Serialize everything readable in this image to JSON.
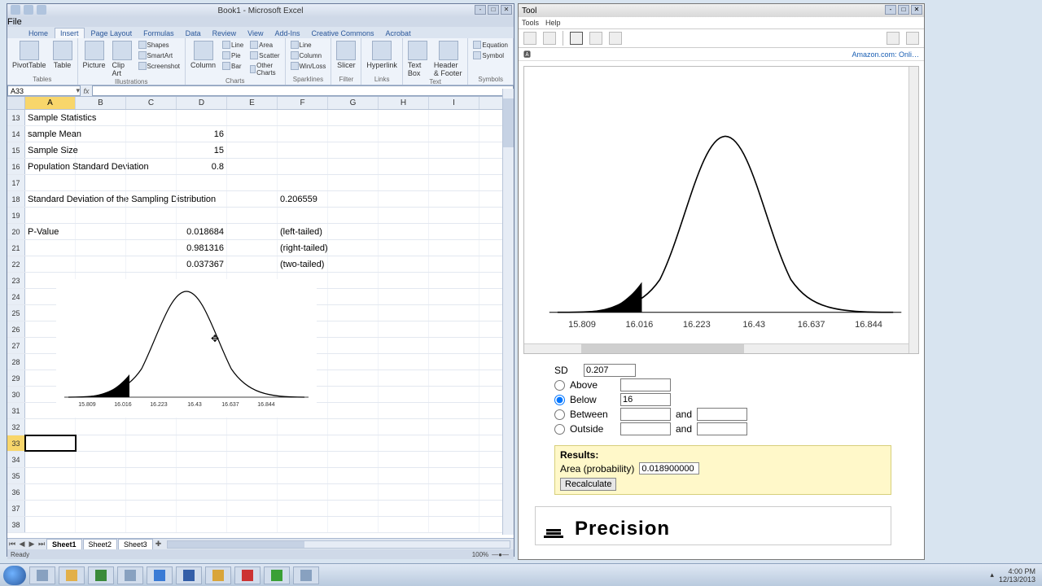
{
  "excel": {
    "title": "Book1 - Microsoft Excel",
    "file_label": "File",
    "tabs": [
      "Home",
      "Insert",
      "Page Layout",
      "Formulas",
      "Data",
      "Review",
      "View",
      "Add-Ins",
      "Creative Commons",
      "Acrobat"
    ],
    "active_tab": 1,
    "ribbon": {
      "tables": {
        "label": "Tables",
        "pivot": "PivotTable",
        "table": "Table"
      },
      "illustrations": {
        "label": "Illustrations",
        "picture": "Picture",
        "clipart": "Clip\nArt",
        "shapes": "Shapes",
        "smartart": "SmartArt",
        "screenshot": "Screenshot"
      },
      "charts": {
        "label": "Charts",
        "column": "Column",
        "line": "Line",
        "pie": "Pie",
        "bar": "Bar",
        "area": "Area",
        "scatter": "Scatter",
        "other": "Other Charts"
      },
      "sparklines": {
        "label": "Sparklines",
        "line": "Line",
        "column": "Column",
        "winloss": "Win/Loss"
      },
      "filter": {
        "label": "Filter",
        "slicer": "Slicer"
      },
      "links": {
        "label": "Links",
        "hyperlink": "Hyperlink"
      },
      "text": {
        "label": "Text",
        "textbox": "Text\nBox",
        "header": "Header\n& Footer"
      },
      "symbols": {
        "label": "Symbols",
        "equation": "Equation",
        "symbol": "Symbol"
      }
    },
    "namebox": "A33",
    "columns": [
      "A",
      "B",
      "C",
      "D",
      "E",
      "F",
      "G",
      "H",
      "I"
    ],
    "rows": [
      {
        "n": 13,
        "A": "Sample Statistics"
      },
      {
        "n": 14,
        "A": "sample Mean",
        "D": "16"
      },
      {
        "n": 15,
        "A": "Sample Size",
        "D": "15"
      },
      {
        "n": 16,
        "A": "Population Standard Deviation",
        "D": "0.8"
      },
      {
        "n": 17
      },
      {
        "n": 18,
        "A": "Standard Deviation of the Sampling Distribution",
        "F": "0.206559"
      },
      {
        "n": 19
      },
      {
        "n": 20,
        "A": "P-Value",
        "D": "0.018684",
        "F": "(left-tailed)"
      },
      {
        "n": 21,
        "D": "0.981316",
        "F": "(right-tailed)"
      },
      {
        "n": 22,
        "D": "0.037367",
        "F": "(two-tailed)"
      },
      {
        "n": 23
      },
      {
        "n": 24
      },
      {
        "n": 25
      },
      {
        "n": 26
      },
      {
        "n": 27
      },
      {
        "n": 28
      },
      {
        "n": 29
      },
      {
        "n": 30
      },
      {
        "n": 31
      },
      {
        "n": 32
      },
      {
        "n": 33,
        "active": true
      },
      {
        "n": 34
      },
      {
        "n": 35
      },
      {
        "n": 36
      },
      {
        "n": 37
      },
      {
        "n": 38
      }
    ],
    "sheets": [
      "Sheet1",
      "Sheet2",
      "Sheet3"
    ],
    "status": "Ready",
    "zoom": "100%"
  },
  "sc": {
    "title": "Tool",
    "menu": [
      "Tools",
      "Help"
    ],
    "url_tab": "Amazon.com: Onli…",
    "form": {
      "sd_label": "SD",
      "sd_value": "0.207",
      "above": "Above",
      "below": "Below",
      "below_value": "16",
      "between": "Between",
      "and": "and",
      "outside": "Outside"
    },
    "results": {
      "header": "Results:",
      "area_label": "Area (probability)",
      "area_value": "0.018900000",
      "recalc": "Recalculate"
    },
    "precision": "Precision"
  },
  "taskbar": {
    "time": "4:00 PM",
    "date": "12/13/2013"
  },
  "chart_data": [
    {
      "type": "line",
      "location": "excel-embedded",
      "title": "",
      "x_ticks": [
        15.809,
        16.016,
        16.223,
        16.43,
        16.637,
        16.844
      ],
      "mean": 16.43,
      "sd": 0.207,
      "shaded": {
        "direction": "left",
        "cutoff": 16.0,
        "area": 0.0189
      }
    },
    {
      "type": "line",
      "location": "statcrunch",
      "title": "",
      "x_ticks": [
        15.809,
        16.016,
        16.223,
        16.43,
        16.637,
        16.844
      ],
      "mean": 16.43,
      "sd": 0.207,
      "shaded": {
        "direction": "left",
        "cutoff": 16.0,
        "area": 0.0189
      }
    }
  ]
}
